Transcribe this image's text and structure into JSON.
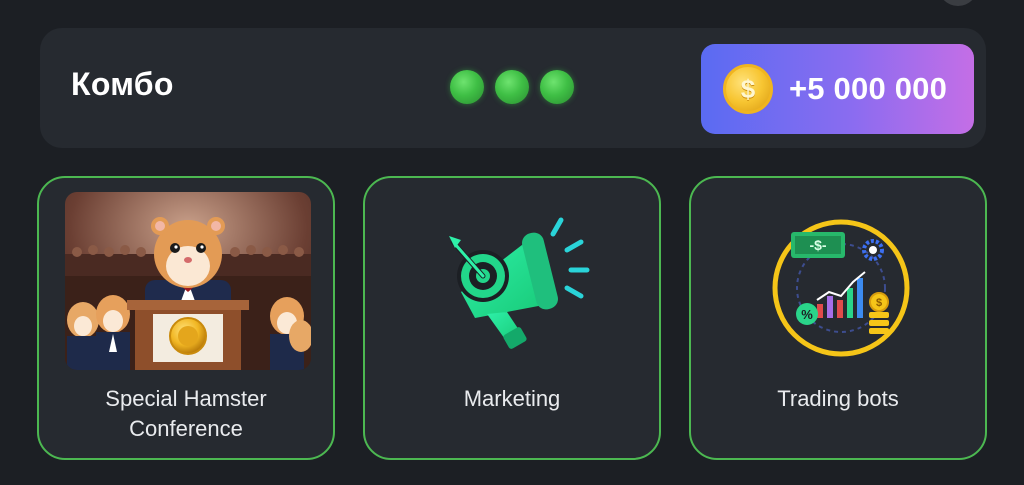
{
  "combo": {
    "title": "Комбо",
    "found_count": 3,
    "reward": {
      "amount": "+5 000 000",
      "icon": "dollar-coin-icon"
    }
  },
  "cards": [
    {
      "label": "Special Hamster Conference",
      "image": "hamster-conference-image"
    },
    {
      "label": "Marketing",
      "icon": "megaphone-target-icon"
    },
    {
      "label": "Trading bots",
      "icon": "trading-bots-icon"
    }
  ],
  "colors": {
    "background": "#1c1f24",
    "panel": "#262a30",
    "card_border": "#4cb851",
    "dot_green": "#3fbf45",
    "reward_gradient_start": "#5a6bf2",
    "reward_gradient_end": "#c46ee6",
    "marketing_green": "#2ee59d",
    "trading_yellow": "#f5c518"
  }
}
